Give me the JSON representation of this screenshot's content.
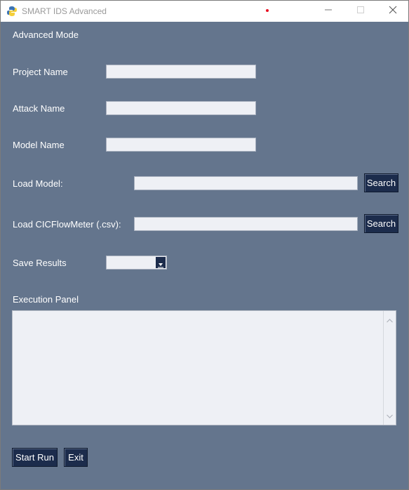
{
  "window": {
    "title": "SMART IDS Advanced"
  },
  "mode_label": "Advanced Mode",
  "form": {
    "project_name": {
      "label": "Project Name",
      "value": ""
    },
    "attack_name": {
      "label": "Attack Name",
      "value": ""
    },
    "model_name": {
      "label": "Model Name",
      "value": ""
    },
    "load_model": {
      "label": "Load Model:",
      "value": "",
      "button": "Search"
    },
    "load_cic": {
      "label": "Load CICFlowMeter (.csv):",
      "value": "",
      "button": "Search"
    },
    "save_results": {
      "label": "Save Results",
      "value": ""
    }
  },
  "execution_panel": {
    "label": "Execution Panel",
    "content": ""
  },
  "actions": {
    "start": "Start Run",
    "exit": "Exit"
  },
  "icons": {
    "app": "python-feather-icon",
    "minimize": "minimize-icon",
    "maximize": "maximize-icon",
    "close": "close-icon",
    "dropdown": "chevron-down-icon"
  },
  "colors": {
    "background": "#64758d",
    "button": "#1c2c4c",
    "field": "#eef0f5",
    "text": "#ffffff"
  }
}
